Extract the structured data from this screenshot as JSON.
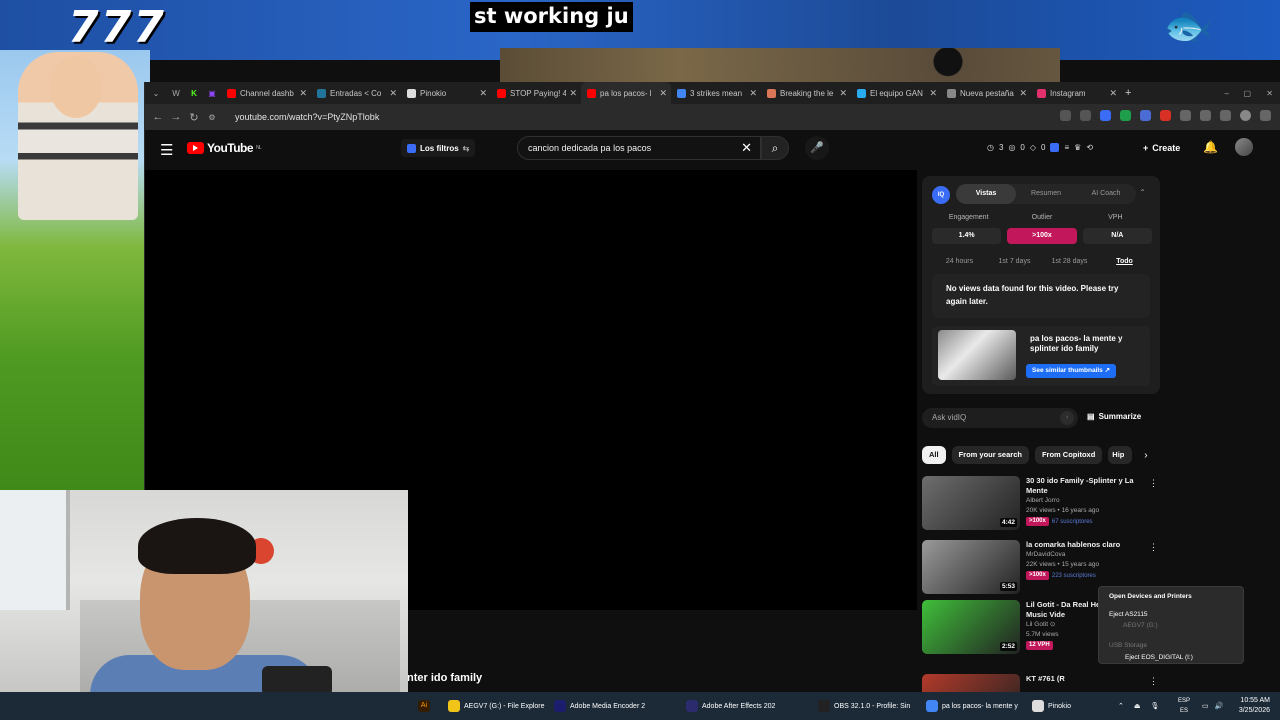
{
  "overlay": {
    "big_number": "777",
    "caption_top": "st working ju",
    "caption_bottom": "nter ido family"
  },
  "browser": {
    "tabs": [
      {
        "label": "Channel dashb",
        "icon_color": "#ff0000"
      },
      {
        "label": "Entradas < Co",
        "icon_color": "#21759b"
      },
      {
        "label": "Pinokio",
        "icon_color": "#dddddd"
      },
      {
        "label": "STOP Paying! 4",
        "icon_color": "#ff0000"
      },
      {
        "label": "pa los pacos- l",
        "icon_color": "#ff0000",
        "active": true
      },
      {
        "label": "3 strikes mean",
        "icon_color": "#4285f4"
      },
      {
        "label": "Breaking the le",
        "icon_color": "#d97757"
      },
      {
        "label": "El equipo GAN",
        "icon_color": "#2aabee"
      },
      {
        "label": "Nueva pestaña",
        "icon_color": "#888888"
      },
      {
        "label": "Instagram",
        "icon_color": "#e1306c"
      }
    ],
    "url": "youtube.com/watch?v=PtyZNpTlobk"
  },
  "youtube": {
    "logo_text": "YouTube",
    "region": "NL",
    "filters_label": "Los filtros",
    "search_value": "cancion dedicada pa los pacos",
    "stats": [
      "3",
      "0",
      "0"
    ],
    "create_label": "Create",
    "video_title_fragment": "nter ido family"
  },
  "vidiq": {
    "logo": "IQ",
    "tabs": [
      "Vistas",
      "Resumen",
      "AI Coach"
    ],
    "metric_labels": [
      "Engagement",
      "Outlier",
      "VPH"
    ],
    "metric_values": [
      "1.4%",
      ">100x",
      "N/A"
    ],
    "ranges": [
      "24 hours",
      "1st 7 days",
      "1st 28 days",
      "Todo"
    ],
    "no_data": "No views data found for this video. Please try again later.",
    "thumb_title": "pa los pacos- la mente y splinter ido family",
    "similar_button": "See similar thumbnails ↗",
    "ask_placeholder": "Ask vidIQ",
    "summarize": "Summarize"
  },
  "chips": [
    "All",
    "From your search",
    "From Copitoxd",
    "Hip"
  ],
  "recommendations": [
    {
      "title": "30 30  ido Family -Splinter y La Mente",
      "channel": "Albert Jorro",
      "meta": "20K views • 16 years ago",
      "badge": ">100x",
      "subs": "67 suscriptores",
      "duration": "4:42",
      "thumb": "#6e6e6e"
    },
    {
      "title": "la comarka hablenos claro",
      "channel": "MrDavidCova",
      "meta": "22K views • 15 years ago",
      "badge": ">100x",
      "subs": "223 suscriptores",
      "duration": "5:53",
      "thumb": "#9a9a9a"
    },
    {
      "title": "Lil Gotit - Da Real He (Official Music Vide",
      "channel": "Lil Gotit ⊙",
      "meta": "5.7M views",
      "badge": "12 VPH",
      "subs": "",
      "duration": "2:52",
      "thumb": "#3fbf3a"
    },
    {
      "title": "KT #761 (R",
      "channel": "",
      "meta": "",
      "badge": "",
      "subs": "",
      "duration": "",
      "thumb": "#b23a2a"
    }
  ],
  "tray_popup": {
    "title": "Open Devices and Printers",
    "eject1": "Eject AS2115",
    "eject1_sub": "AEGV7 (G:)",
    "section": "USB Storage",
    "eject2": "Eject EOS_DIGITAL (I:)"
  },
  "taskbar": {
    "items": [
      {
        "label": "AEGV7 (G:) - File Explore",
        "color": "#f0c419"
      },
      {
        "label": "Adobe Media Encoder 2",
        "color": "#1d1d6e"
      },
      {
        "label": "Adobe After Effects 202",
        "color": "#2b2b6e"
      },
      {
        "label": "OBS 32.1.0 - Profile: Sin",
        "color": "#222222"
      },
      {
        "label": "pa los pacos- la mente y",
        "color": "#4285f4"
      },
      {
        "label": "Pinokio",
        "color": "#dddddd"
      }
    ],
    "lang_top": "ESP",
    "lang_bottom": "ES",
    "time": "10:55 AM",
    "date": "3/25/2026"
  }
}
